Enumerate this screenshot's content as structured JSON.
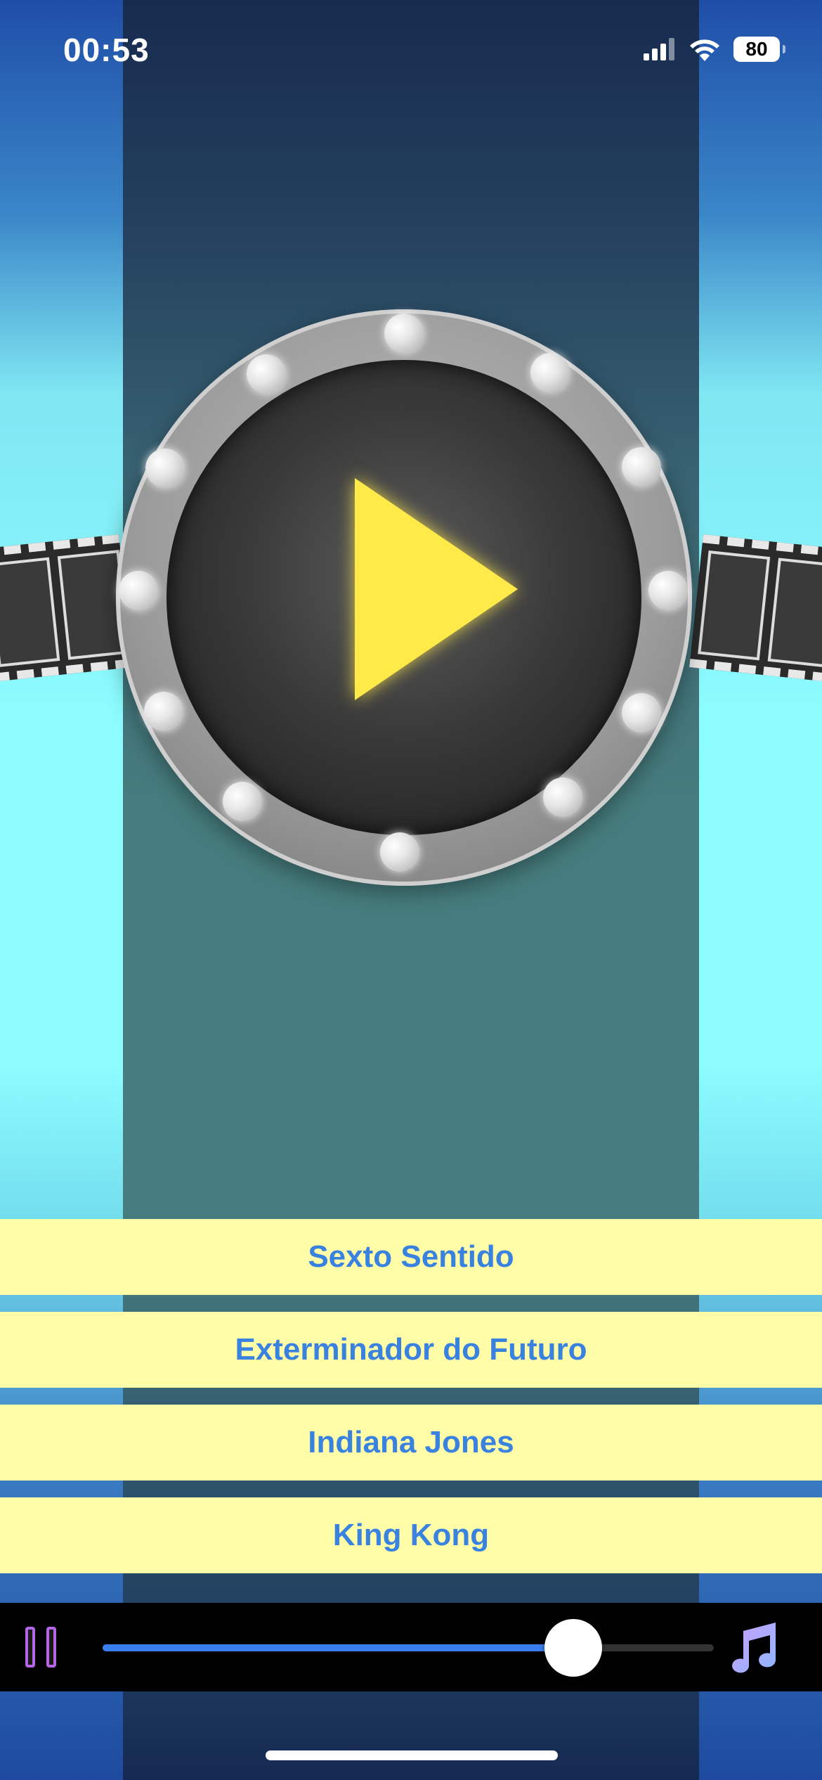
{
  "status_bar": {
    "time": "00:53",
    "battery": "80",
    "icons": [
      "signal-icon",
      "wifi-icon",
      "battery-icon"
    ]
  },
  "player": {
    "play_icon": "play-icon",
    "accent_color": "#ffea4a"
  },
  "songs": [
    {
      "label": "Sexto Sentido"
    },
    {
      "label": "Exterminador do Futuro"
    },
    {
      "label": "Indiana Jones"
    },
    {
      "label": "King Kong"
    }
  ],
  "player_bar": {
    "pause_icon": "pause-icon",
    "music_icon": "music-note-icon",
    "progress": 0.77,
    "progress_color": "#3a7ff0"
  },
  "colors": {
    "song_button_bg": "#fffda8",
    "song_button_text": "#3a82df"
  }
}
